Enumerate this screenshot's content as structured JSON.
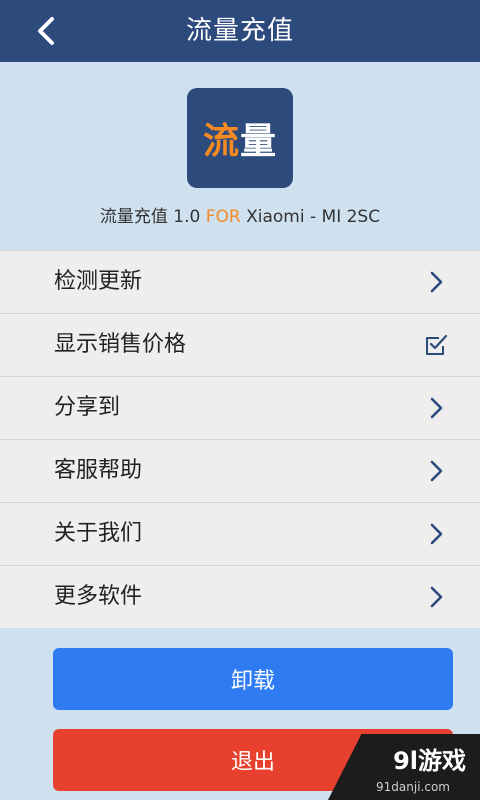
{
  "header": {
    "back_icon": "chevron-left-icon",
    "title": "流量充值"
  },
  "app": {
    "logo_text_1": "流",
    "logo_text_2": "量",
    "version_prefix": "流量充值 1.0 ",
    "version_for": "FOR",
    "version_suffix": " Xiaomi - MI 2SC",
    "colors": {
      "brand": "#2c4a7c",
      "accent": "#f58a23"
    }
  },
  "menu": {
    "items": [
      {
        "label": "检测更新",
        "icon": "chevron-right-icon"
      },
      {
        "label": "显示销售价格",
        "icon": "checkbox-checked-icon"
      },
      {
        "label": "分享到",
        "icon": "chevron-right-icon"
      },
      {
        "label": "客服帮助",
        "icon": "chevron-right-icon"
      },
      {
        "label": "关于我们",
        "icon": "chevron-right-icon"
      },
      {
        "label": "更多软件",
        "icon": "chevron-right-icon"
      }
    ]
  },
  "buttons": {
    "uninstall_label": "卸载",
    "exit_label": "退出",
    "colors": {
      "uninstall": "#2f7cf2",
      "exit": "#e8402f"
    }
  },
  "watermark": {
    "text": "9l游戏",
    "sub": "91danji.com"
  }
}
